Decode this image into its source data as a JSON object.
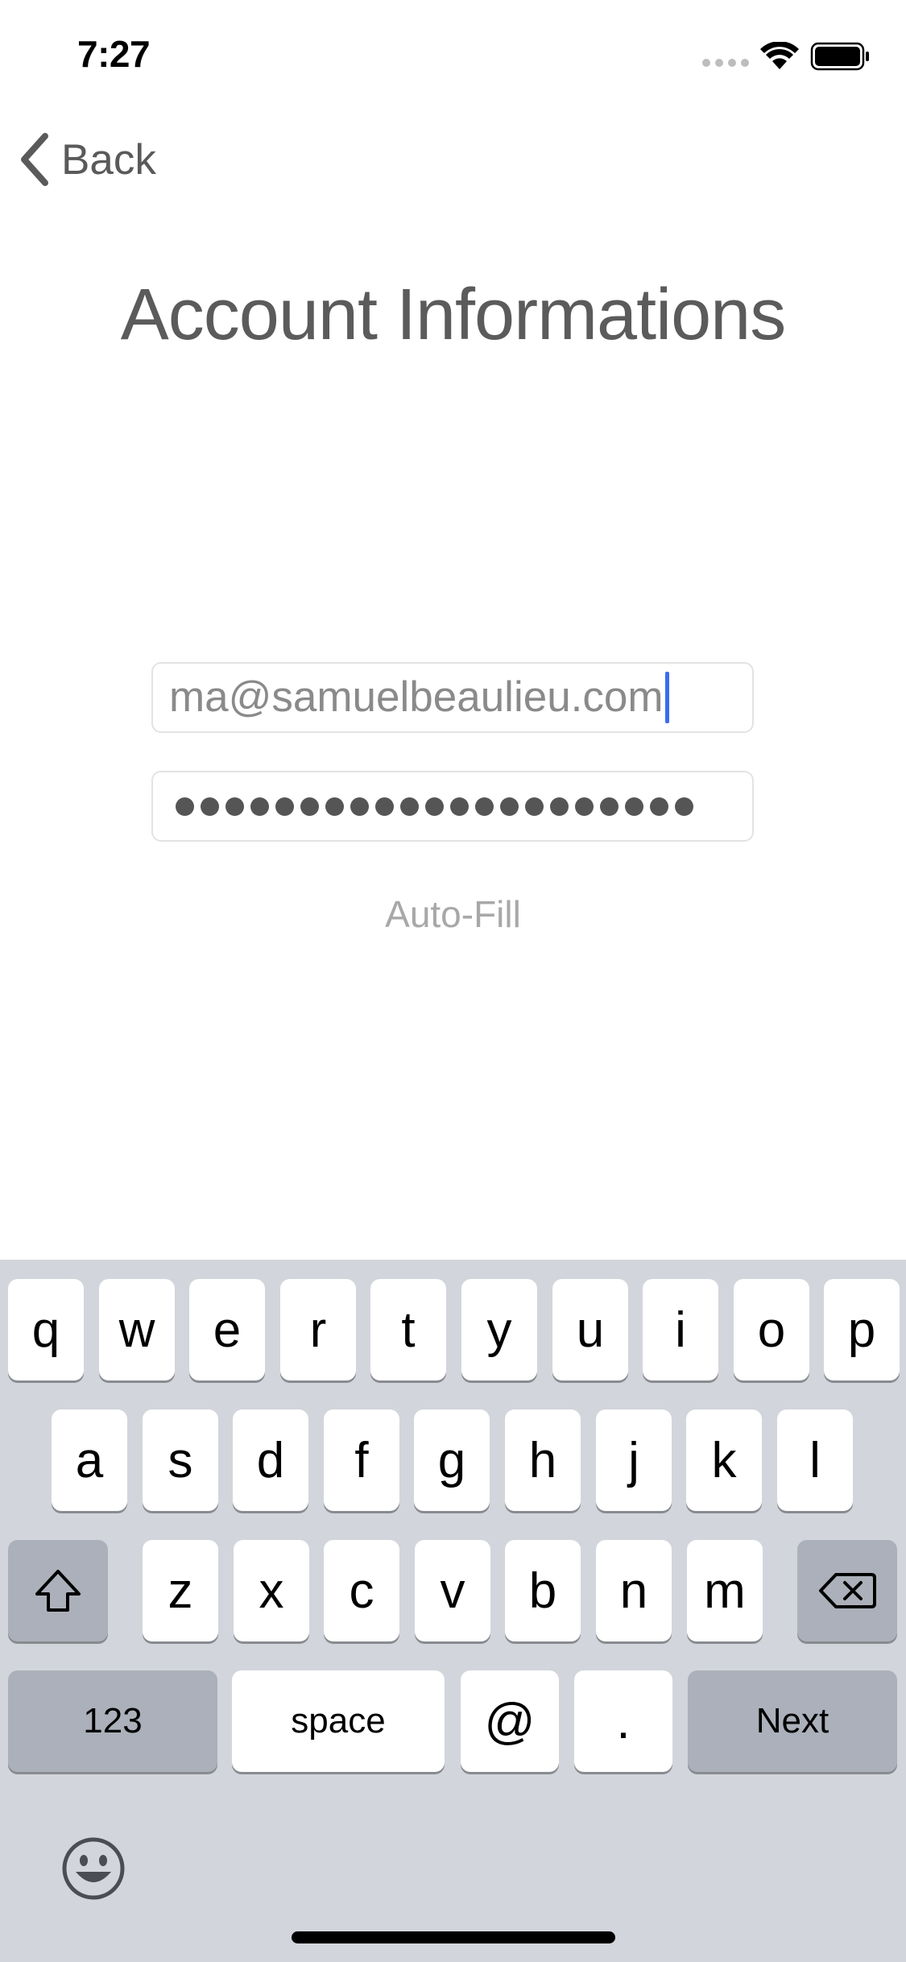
{
  "status_bar": {
    "time": "7:27"
  },
  "nav": {
    "back_label": "Back"
  },
  "title": "Account Informations",
  "form": {
    "email_value": "ma@samuelbeaulieu.com",
    "password_length": 21,
    "autofill_label": "Auto-Fill"
  },
  "keyboard": {
    "row1": [
      "q",
      "w",
      "e",
      "r",
      "t",
      "y",
      "u",
      "i",
      "o",
      "p"
    ],
    "row2": [
      "a",
      "s",
      "d",
      "f",
      "g",
      "h",
      "j",
      "k",
      "l"
    ],
    "row3": [
      "z",
      "x",
      "c",
      "v",
      "b",
      "n",
      "m"
    ],
    "numbers_label": "123",
    "space_label": "space",
    "at_label": "@",
    "dot_label": ".",
    "next_label": "Next"
  },
  "colors": {
    "accent": "#3a6cf2",
    "keyboard_bg": "#d2d5db",
    "key_gray": "#abb0ba"
  }
}
